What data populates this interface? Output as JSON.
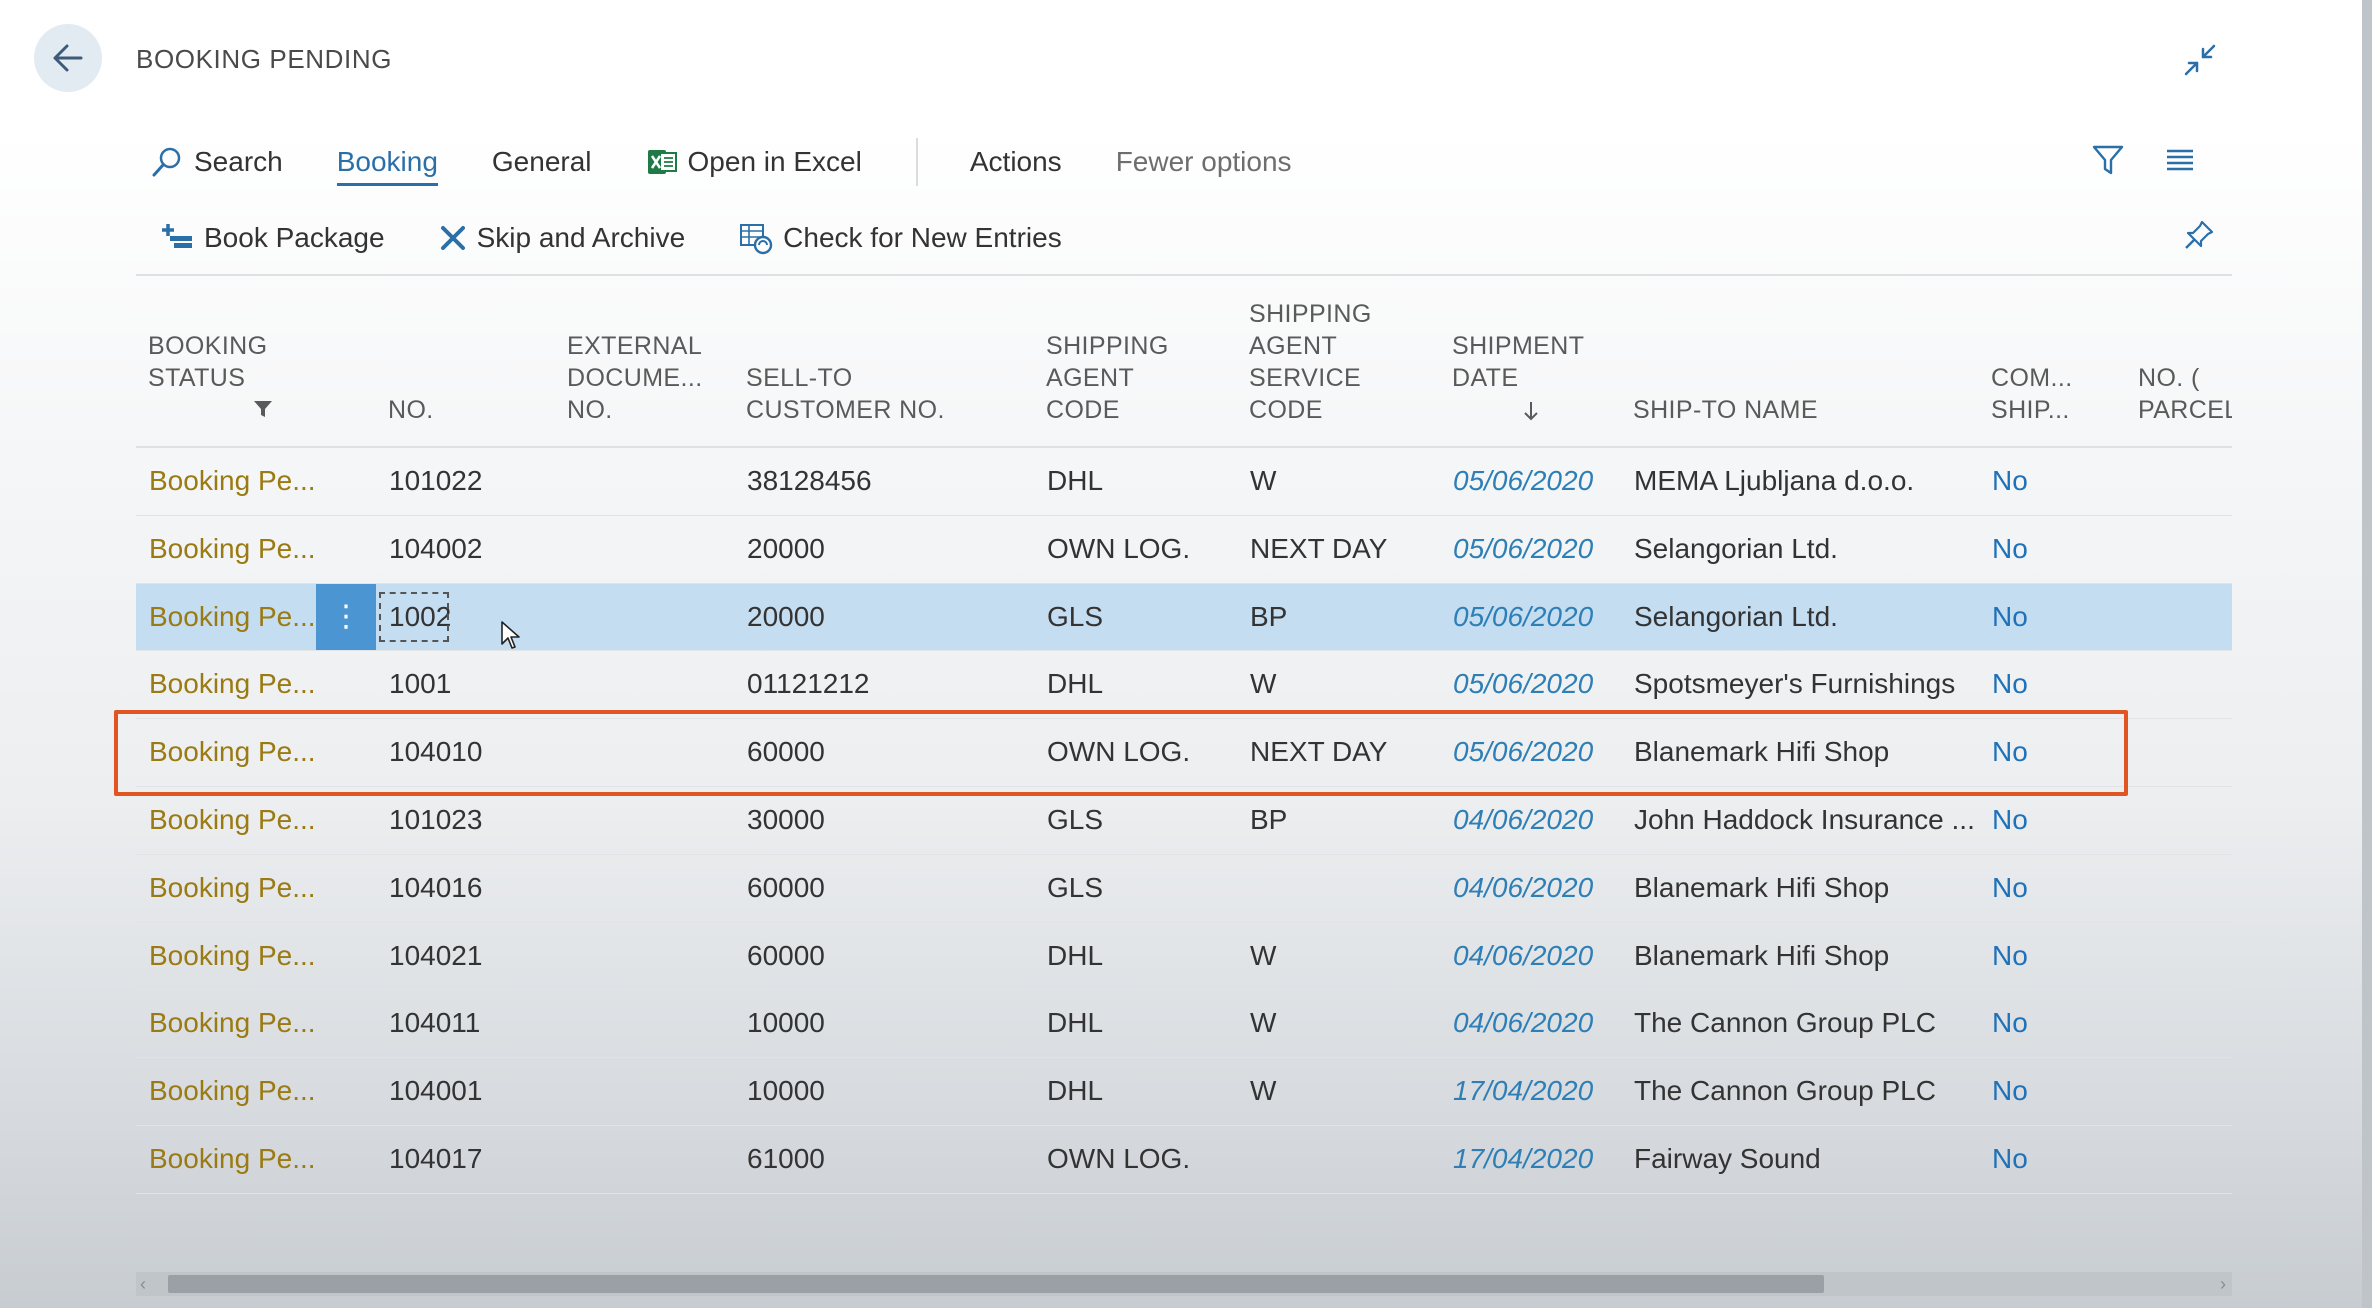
{
  "page": {
    "title": "BOOKING PENDING"
  },
  "menu": {
    "search": "Search",
    "booking": "Booking",
    "general": "General",
    "open_excel": "Open in Excel",
    "actions": "Actions",
    "fewer_options": "Fewer options"
  },
  "actions": {
    "book_package": "Book Package",
    "skip_archive": "Skip and Archive",
    "check_new": "Check for New Entries"
  },
  "columns": {
    "status": "BOOKING\nSTATUS",
    "no": "NO.",
    "external": "EXTERNAL\nDOCUME...\nNO.",
    "sell_to": "SELL-TO\nCUSTOMER NO.",
    "agent_code": "SHIPPING\nAGENT\nCODE",
    "service_code": "SHIPPING\nAGENT\nSERVICE\nCODE",
    "shipment_date": "SHIPMENT\nDATE",
    "ship_to_name": "SHIP-TO NAME",
    "com_ship": "COM...\nSHIP...",
    "parcels": "NO. (\nPARCEL"
  },
  "rows": [
    {
      "status": "Booking Pe...",
      "no": "101022",
      "sell_to": "38128456",
      "agent": "DHL",
      "service": "W",
      "date": "05/06/2020",
      "name": "MEMA Ljubljana d.o.o.",
      "ship": "No"
    },
    {
      "status": "Booking Pe...",
      "no": "104002",
      "sell_to": "20000",
      "agent": "OWN LOG.",
      "service": "NEXT DAY",
      "date": "05/06/2020",
      "name": "Selangorian Ltd.",
      "ship": "No"
    },
    {
      "status": "Booking Pe...",
      "no": "1002",
      "sell_to": "20000",
      "agent": "GLS",
      "service": "BP",
      "date": "05/06/2020",
      "name": "Selangorian Ltd.",
      "ship": "No"
    },
    {
      "status": "Booking Pe...",
      "no": "1001",
      "sell_to": "01121212",
      "agent": "DHL",
      "service": "W",
      "date": "05/06/2020",
      "name": "Spotsmeyer's Furnishings",
      "ship": "No"
    },
    {
      "status": "Booking Pe...",
      "no": "104010",
      "sell_to": "60000",
      "agent": "OWN LOG.",
      "service": "NEXT DAY",
      "date": "05/06/2020",
      "name": "Blanemark Hifi Shop",
      "ship": "No"
    },
    {
      "status": "Booking Pe...",
      "no": "101023",
      "sell_to": "30000",
      "agent": "GLS",
      "service": "BP",
      "date": "04/06/2020",
      "name": "John Haddock Insurance ...",
      "ship": "No"
    },
    {
      "status": "Booking Pe...",
      "no": "104016",
      "sell_to": "60000",
      "agent": "GLS",
      "service": "",
      "date": "04/06/2020",
      "name": "Blanemark Hifi Shop",
      "ship": "No"
    },
    {
      "status": "Booking Pe...",
      "no": "104021",
      "sell_to": "60000",
      "agent": "DHL",
      "service": "W",
      "date": "04/06/2020",
      "name": "Blanemark Hifi Shop",
      "ship": "No"
    },
    {
      "status": "Booking Pe...",
      "no": "104011",
      "sell_to": "10000",
      "agent": "DHL",
      "service": "W",
      "date": "04/06/2020",
      "name": "The Cannon Group PLC",
      "ship": "No"
    },
    {
      "status": "Booking Pe...",
      "no": "104001",
      "sell_to": "10000",
      "agent": "DHL",
      "service": "W",
      "date": "17/04/2020",
      "name": "The Cannon Group PLC",
      "ship": "No"
    },
    {
      "status": "Booking Pe...",
      "no": "104017",
      "sell_to": "61000",
      "agent": "OWN LOG.",
      "service": "",
      "date": "17/04/2020",
      "name": "Fairway Sound",
      "ship": "No"
    }
  ],
  "selected_row_index": 2,
  "highlighted_row_index": 4,
  "colors": {
    "accent": "#2b6fa8",
    "status_text": "#9a7a12",
    "date_text": "#2e7fb6",
    "selected_row": "#c5ddf1",
    "highlight_border": "#e05522"
  },
  "icons": {
    "back": "arrow-left-icon",
    "collapse": "collapse-arrows-icon",
    "search": "magnifier-icon",
    "excel": "excel-icon",
    "filter": "funnel-icon",
    "list": "list-icon",
    "book_package": "add-package-icon",
    "skip": "x-icon",
    "check": "refresh-table-icon",
    "pin": "pin-icon"
  }
}
